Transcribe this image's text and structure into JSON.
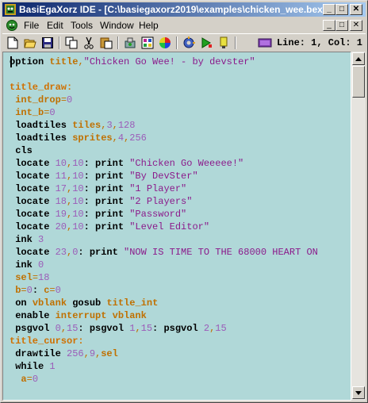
{
  "window": {
    "title": "BasiEgaXorz IDE - [C:\\basiegaxorz2019\\examples\\chicken_wee.bex]",
    "minimize_glyph": "_",
    "maximize_glyph": "□",
    "close_glyph": "✕"
  },
  "menu": {
    "items": [
      "File",
      "Edit",
      "Tools",
      "Window",
      "Help"
    ]
  },
  "toolbar": {
    "status": "Line: 1, Col: 1",
    "icons": [
      "new-file-icon",
      "open-folder-icon",
      "save-icon",
      "copy-icon",
      "cut-icon",
      "paste-icon",
      "build-icon",
      "palette-editor-icon",
      "color-wheel-icon",
      "gear-icon",
      "run-icon",
      "flash-icon",
      "emulator-icon"
    ]
  },
  "editor": {
    "lines": [
      [
        [
          "kw",
          "option "
        ],
        [
          "var",
          "title"
        ],
        [
          "op",
          ","
        ],
        [
          "str",
          "\"Chicken Go Wee! - by devster\""
        ]
      ],
      [],
      [
        [
          "lb",
          "title_draw:"
        ]
      ],
      [
        [
          "var",
          " int_drop"
        ],
        [
          "op",
          "="
        ],
        [
          "num",
          "0"
        ]
      ],
      [
        [
          "var",
          " int_b"
        ],
        [
          "op",
          "="
        ],
        [
          "num",
          "0"
        ]
      ],
      [
        [
          "kw",
          " loadtiles "
        ],
        [
          "var",
          "tiles"
        ],
        [
          "op",
          ","
        ],
        [
          "num",
          "3"
        ],
        [
          "op",
          ","
        ],
        [
          "num",
          "128"
        ]
      ],
      [
        [
          "kw",
          " loadtiles "
        ],
        [
          "var",
          "sprites"
        ],
        [
          "op",
          ","
        ],
        [
          "num",
          "4"
        ],
        [
          "op",
          ","
        ],
        [
          "num",
          "256"
        ]
      ],
      [
        [
          "kw",
          " cls"
        ]
      ],
      [
        [
          "kw",
          " locate "
        ],
        [
          "num",
          "10"
        ],
        [
          "op",
          ","
        ],
        [
          "num",
          "10"
        ],
        [
          "kw",
          ": print "
        ],
        [
          "str",
          "\"Chicken Go Weeeee!\""
        ]
      ],
      [
        [
          "kw",
          " locate "
        ],
        [
          "num",
          "11"
        ],
        [
          "op",
          ","
        ],
        [
          "num",
          "10"
        ],
        [
          "kw",
          ": print "
        ],
        [
          "str",
          "\"By DevSter\""
        ]
      ],
      [
        [
          "kw",
          " locate "
        ],
        [
          "num",
          "17"
        ],
        [
          "op",
          ","
        ],
        [
          "num",
          "10"
        ],
        [
          "kw",
          ": print "
        ],
        [
          "str",
          "\"1 Player\""
        ]
      ],
      [
        [
          "kw",
          " locate "
        ],
        [
          "num",
          "18"
        ],
        [
          "op",
          ","
        ],
        [
          "num",
          "10"
        ],
        [
          "kw",
          ": print "
        ],
        [
          "str",
          "\"2 Players\""
        ]
      ],
      [
        [
          "kw",
          " locate "
        ],
        [
          "num",
          "19"
        ],
        [
          "op",
          ","
        ],
        [
          "num",
          "10"
        ],
        [
          "kw",
          ": print "
        ],
        [
          "str",
          "\"Password\""
        ]
      ],
      [
        [
          "kw",
          " locate "
        ],
        [
          "num",
          "20"
        ],
        [
          "op",
          ","
        ],
        [
          "num",
          "10"
        ],
        [
          "kw",
          ": print "
        ],
        [
          "str",
          "\"Level Editor\""
        ]
      ],
      [
        [
          "kw",
          " ink "
        ],
        [
          "num",
          "3"
        ]
      ],
      [
        [
          "kw",
          " locate "
        ],
        [
          "num",
          "23"
        ],
        [
          "op",
          ","
        ],
        [
          "num",
          "0"
        ],
        [
          "kw",
          ": print "
        ],
        [
          "str",
          "\"NOW IS TIME TO THE 68000 HEART ON"
        ]
      ],
      [
        [
          "kw",
          " ink "
        ],
        [
          "num",
          "0"
        ]
      ],
      [
        [
          "var",
          " sel"
        ],
        [
          "op",
          "="
        ],
        [
          "num",
          "18"
        ]
      ],
      [
        [
          "var",
          " b"
        ],
        [
          "op",
          "="
        ],
        [
          "num",
          "0"
        ],
        [
          "kw",
          ": "
        ],
        [
          "var",
          "c"
        ],
        [
          "op",
          "="
        ],
        [
          "num",
          "0"
        ]
      ],
      [
        [
          "kw",
          " on "
        ],
        [
          "var",
          "vblank "
        ],
        [
          "kw",
          "gosub "
        ],
        [
          "var",
          "title_int"
        ]
      ],
      [
        [
          "kw",
          " enable "
        ],
        [
          "var",
          "interrupt vblank"
        ]
      ],
      [
        [
          "kw",
          " psgvol "
        ],
        [
          "num",
          "0"
        ],
        [
          "op",
          ","
        ],
        [
          "num",
          "15"
        ],
        [
          "kw",
          ": psgvol "
        ],
        [
          "num",
          "1"
        ],
        [
          "op",
          ","
        ],
        [
          "num",
          "15"
        ],
        [
          "kw",
          ": psgvol "
        ],
        [
          "num",
          "2"
        ],
        [
          "op",
          ","
        ],
        [
          "num",
          "15"
        ]
      ],
      [
        [
          "lb",
          "title_cursor:"
        ]
      ],
      [
        [
          "kw",
          " drawtile "
        ],
        [
          "num",
          "256"
        ],
        [
          "op",
          ","
        ],
        [
          "num",
          "9"
        ],
        [
          "op",
          ","
        ],
        [
          "var",
          "sel"
        ]
      ],
      [
        [
          "kw",
          " while "
        ],
        [
          "num",
          "1"
        ]
      ],
      [
        [
          "var",
          "  a"
        ],
        [
          "op",
          "="
        ],
        [
          "num",
          "0"
        ]
      ]
    ]
  }
}
